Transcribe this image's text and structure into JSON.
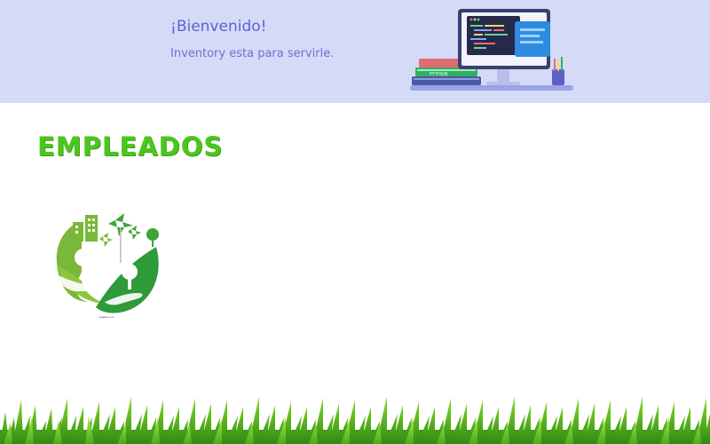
{
  "banner": {
    "title": "¡Bienvenido!",
    "subtitle": "Inventory esta para servirle.",
    "illustration_icon": "computer-code-python-icon",
    "background_color": "#d5daf7",
    "text_color": "#5b63cf"
  },
  "main": {
    "section_title": "Empleados",
    "title_color": "#4bc61f",
    "logo_icon": "eco-hands-city-icon",
    "logo_caption": "pngtree.com"
  },
  "footer": {
    "decoration_icon": "grass-icon"
  }
}
